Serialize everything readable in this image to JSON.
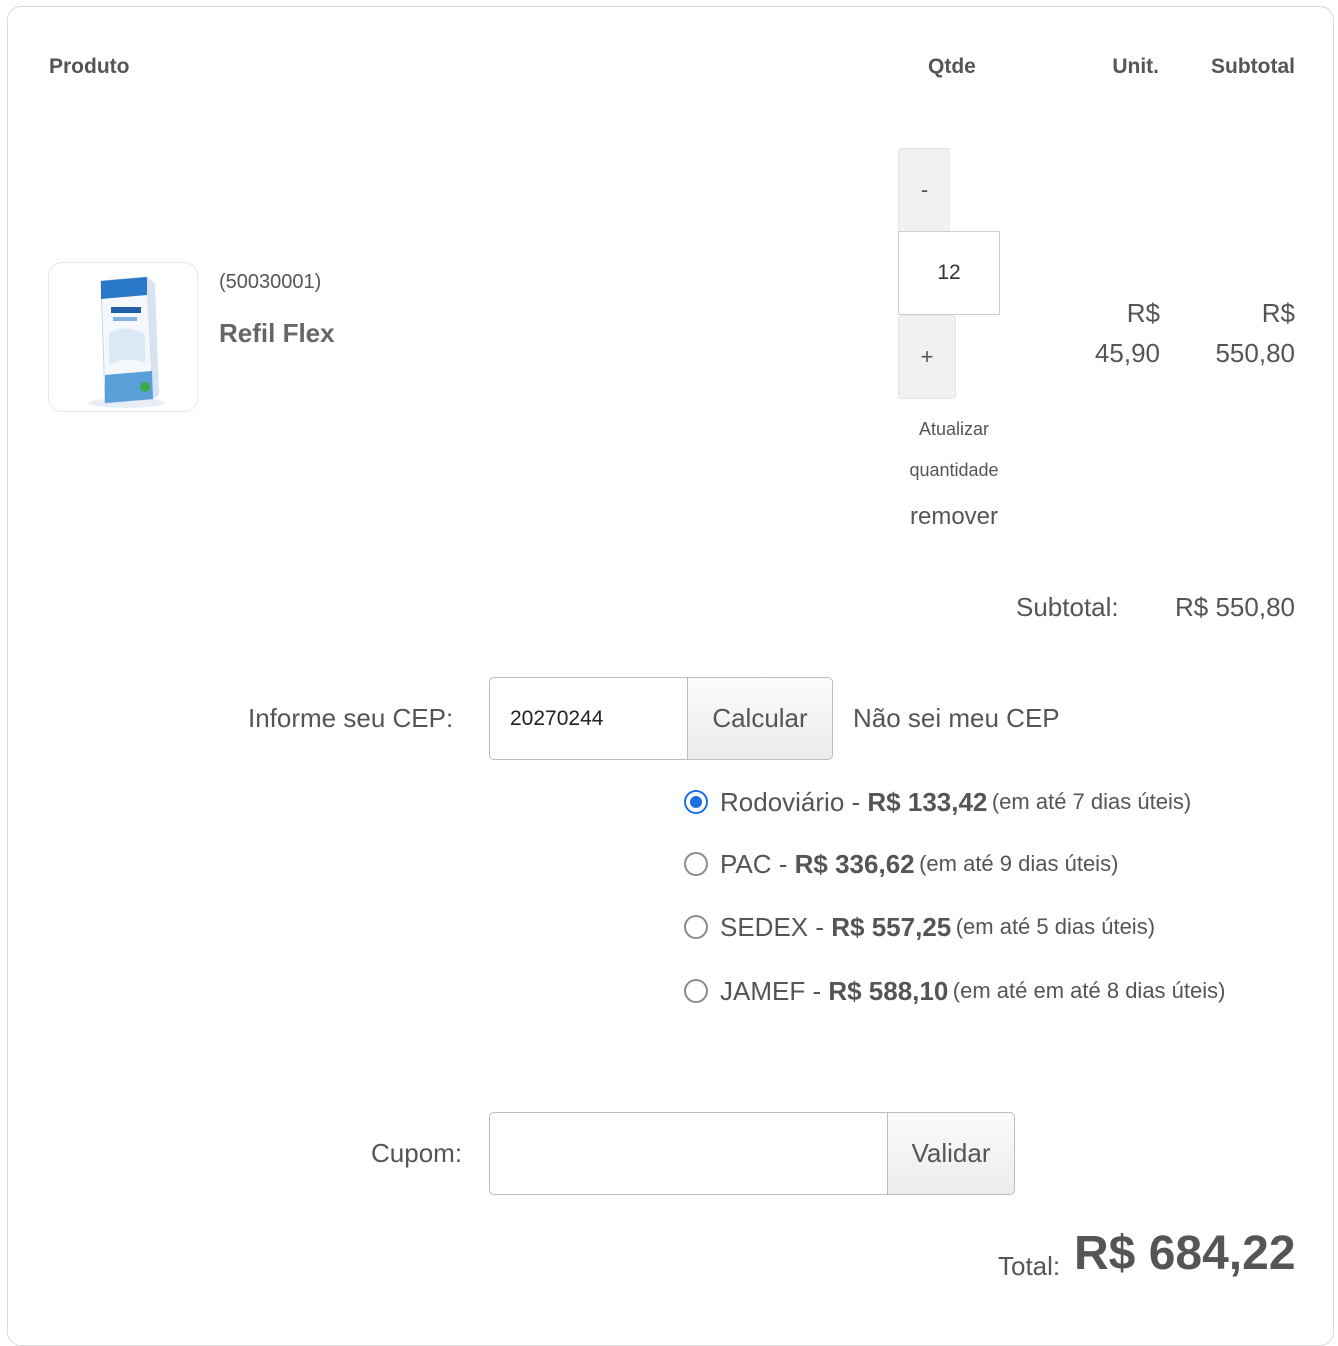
{
  "table": {
    "headers": {
      "product": "Produto",
      "qty": "Qtde",
      "unit": "Unit.",
      "subtotal": "Subtotal"
    }
  },
  "item": {
    "code": "(50030001)",
    "name": "Refil Flex",
    "image_icon": "product-box-image",
    "minus_label": "-",
    "plus_label": "+",
    "quantity": "12",
    "update_line1": "Atualizar",
    "update_line2": "quantidade",
    "remove_label": "remover",
    "unit_currency": "R$",
    "unit_value": "45,90",
    "subtotal_currency": "R$",
    "subtotal_value": "550,80"
  },
  "summary": {
    "subtotal_label": "Subtotal:",
    "subtotal_value": "R$ 550,80"
  },
  "shipping": {
    "cep_label": "Informe seu CEP:",
    "cep_value": "20270244",
    "calc_button": "Calcular",
    "help_link": "Não sei meu CEP",
    "selected_color": "#1a6fe0",
    "options": [
      {
        "name": "Rodoviário",
        "sep": " - ",
        "price": "R$ 133,42",
        "days": "(em até 7 dias úteis)",
        "selected": true
      },
      {
        "name": "PAC",
        "sep": " - ",
        "price": "R$ 336,62",
        "days": "(em até 9 dias úteis)",
        "selected": false
      },
      {
        "name": "SEDEX",
        "sep": " - ",
        "price": "R$ 557,25",
        "days": "(em até 5 dias úteis)",
        "selected": false
      },
      {
        "name": "JAMEF",
        "sep": " - ",
        "price": "R$ 588,10",
        "days": "(em até em até 8 dias úteis)",
        "selected": false
      }
    ]
  },
  "coupon": {
    "label": "Cupom:",
    "value": "",
    "button": "Validar"
  },
  "total": {
    "label": "Total:",
    "value": "R$ 684,22"
  }
}
